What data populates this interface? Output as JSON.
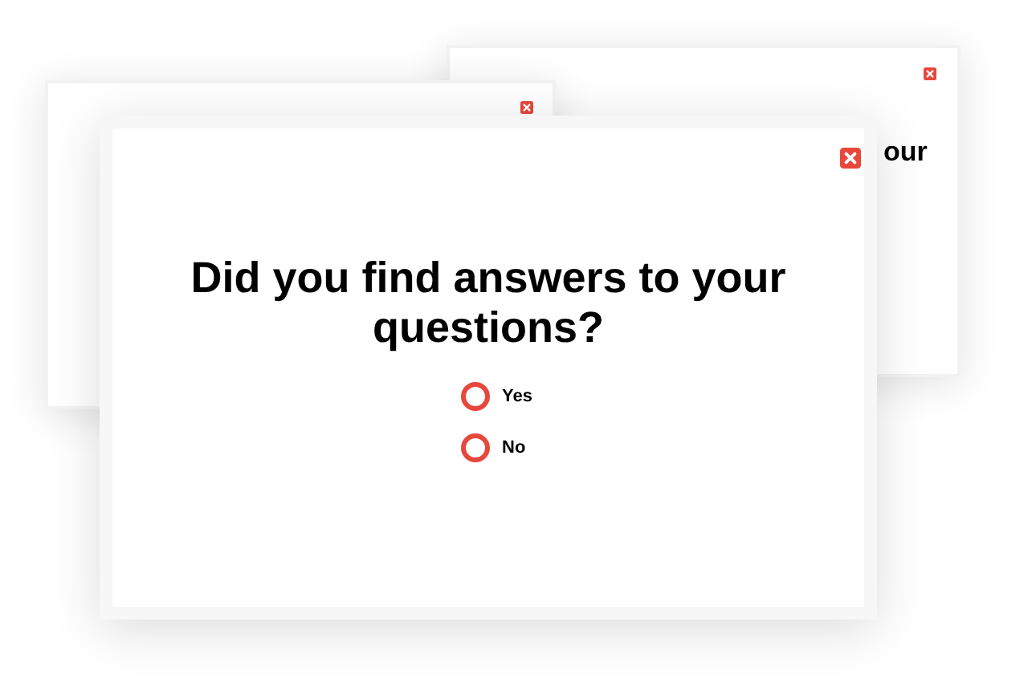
{
  "back_cards": [
    {
      "kind": "titled",
      "title_fragment": "our"
    },
    {
      "kind": "blank"
    }
  ],
  "popup": {
    "question": "Did you find answers to your questions?",
    "options": [
      {
        "label": "Yes",
        "selected": false
      },
      {
        "label": "No",
        "selected": false
      }
    ]
  }
}
